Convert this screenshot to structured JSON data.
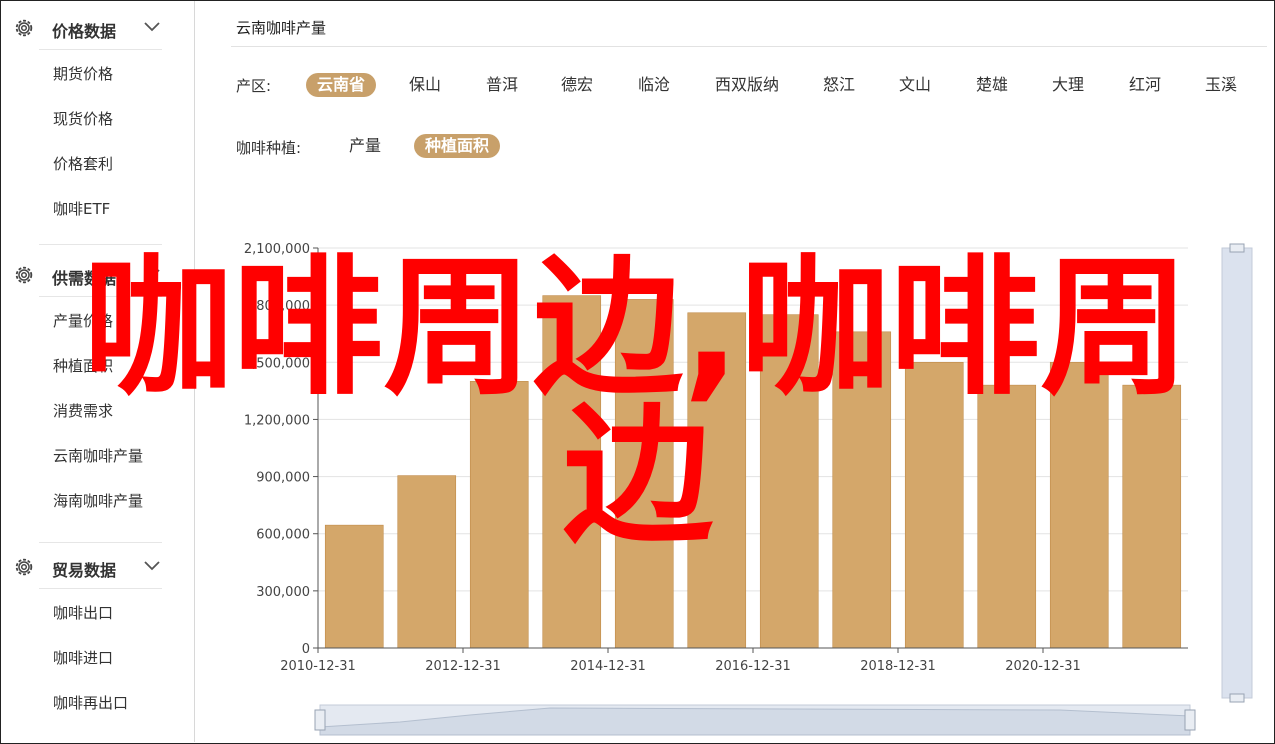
{
  "sidebar": {
    "groups": [
      {
        "title": "价格数据",
        "items": [
          "期货价格",
          "现货价格",
          "价格套利",
          "咖啡ETF"
        ]
      },
      {
        "title": "供需数据",
        "items": [
          "产量价格",
          "种植面积",
          "消费需求",
          "云南咖啡产量",
          "海南咖啡产量"
        ]
      },
      {
        "title": "贸易数据",
        "items": [
          "咖啡出口",
          "咖啡进口",
          "咖啡再出口"
        ]
      }
    ]
  },
  "main": {
    "title": "云南咖啡产量",
    "region": {
      "label": "产区:",
      "options": [
        "云南省",
        "保山",
        "普洱",
        "德宏",
        "临沧",
        "西双版纳",
        "怒江",
        "文山",
        "楚雄",
        "大理",
        "红河",
        "玉溪"
      ],
      "selected": 0
    },
    "variety": {
      "label": "咖啡种植:",
      "options": [
        "产量",
        "种植面积"
      ],
      "selected": 1
    }
  },
  "overlay": {
    "line1": "咖啡周边,咖啡周",
    "line2": "边",
    "color": "#ff0000"
  },
  "colors": {
    "accent": "#c8a06a",
    "bar": "#d4a76a",
    "bar_stroke": "#c08a48",
    "grid": "#e3e3e3"
  },
  "chart_data": {
    "type": "bar",
    "x": [
      "2010-12-31",
      "2011-12-31",
      "2012-12-31",
      "2013-12-31",
      "2014-12-31",
      "2015-12-31",
      "2016-12-31",
      "2017-12-31",
      "2018-12-31",
      "2019-12-31",
      "2020-12-31",
      "2021-12-31"
    ],
    "values": [
      645000,
      905000,
      1400000,
      1850000,
      1830000,
      1760000,
      1750000,
      1660000,
      1500000,
      1380000,
      1500000,
      1380000
    ],
    "x_tick_labels": [
      "2010-12-31",
      "2012-12-31",
      "2014-12-31",
      "2016-12-31",
      "2018-12-31",
      "2020-12-31"
    ],
    "y_tick_labels": [
      "0",
      "300,000",
      "600,000",
      "900,000",
      "1,200,000",
      "1,500,000",
      "1,800,000",
      "2,100,000"
    ],
    "ylim": [
      0,
      2100000
    ],
    "grid": true,
    "legend": "none"
  }
}
